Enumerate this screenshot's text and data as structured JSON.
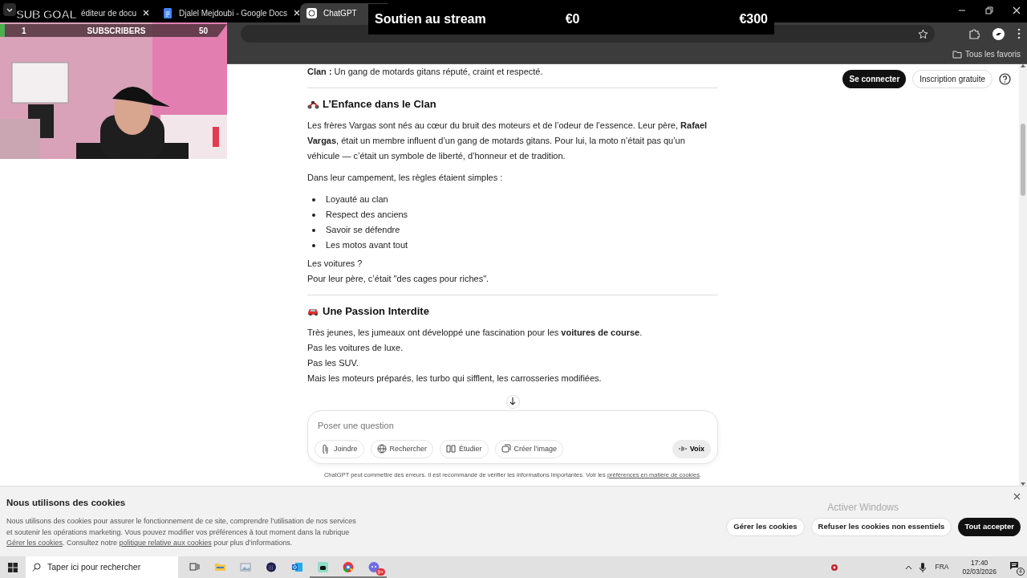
{
  "browser": {
    "tabs": [
      {
        "label": "éditeur de docu",
        "selected": false
      },
      {
        "label": "Djalel Mejdoubi - Google Docs",
        "selected": false
      },
      {
        "label": "ChatGPT",
        "selected": true
      }
    ],
    "bookmarks": [
      "Tous les favoris"
    ]
  },
  "page": {
    "header_buttons": [
      {
        "label": "Se connecter",
        "kind": "primary"
      },
      {
        "label": "Inscription gratuite",
        "kind": "outline"
      }
    ],
    "blocks": [
      {
        "kind": "paragraph",
        "text": "**Clan :** Un gang de motards gitans réputé, craint et respecté."
      },
      {
        "kind": "divider"
      },
      {
        "kind": "heading",
        "text": "L’Enfance dans le Clan"
      },
      {
        "kind": "paragraph",
        "text": "Les frères Vargas sont nés au cœur du bruit des moteurs et de l’odeur de l’essence. Leur père, **Rafael Vargas**, était un membre influent d’un gang de motards gitans. Pour lui, la moto n’était pas qu’un véhicule — c’était un symbole de liberté, d’honneur et de tradition."
      },
      {
        "kind": "paragraph",
        "text": "Dans leur campement, les règles étaient simples :"
      },
      {
        "kind": "list",
        "items": [
          "Loyauté au clan",
          "Respect des anciens",
          "Savoir se défendre",
          "Les motos avant tout"
        ]
      },
      {
        "kind": "lines",
        "lines": [
          "Les voitures ?",
          "Pour leur père, c’était \"des cages pour riches\"."
        ]
      },
      {
        "kind": "divider"
      },
      {
        "kind": "heading",
        "text": "Une Passion Interdite"
      },
      {
        "kind": "lines",
        "lines": [
          "Très jeunes, les jumeaux ont développé une fascination pour les **voitures de course**.",
          "Pas les voitures de luxe.",
          "Pas les SUV.",
          "Mais les moteurs préparés, les turbo qui sifflent, les carrosseries modifiées."
        ]
      }
    ]
  },
  "composer": {
    "placeholder": "Poser une question",
    "tools": [
      "Joindre",
      "Rechercher",
      "Étudier",
      "Créer l’image"
    ],
    "voice": "Voix"
  },
  "disclaimer": {
    "text": "ChatGPT peut commettre des erreurs. Il est recommandé de vérifier les informations importantes. Voir les",
    "link": "préférences en matière de cookies",
    "end": "."
  },
  "cookie_banner": {
    "title": "Nous utilisons des cookies",
    "body": [
      "Nous utilisons des cookies pour assurer le fonctionnement de ce site, comprendre l’utilisation de nos services et soutenir les opérations marketing. Vous pouvez modifier vos préférences à tout moment dans la rubrique ",
      {
        "link": "Gérer les cookies"
      },
      ". Consultez notre ",
      {
        "link": "politique relative aux cookies"
      },
      " pour plus d’informations."
    ],
    "buttons": [
      {
        "label": "Gérer les cookies",
        "kind": "outline"
      },
      {
        "label": "Refuser les cookies non essentiels",
        "kind": "outline"
      },
      {
        "label": "Tout accepter",
        "kind": "primary"
      }
    ]
  },
  "windows_notice": "Activer Windows",
  "taskbar": {
    "search_placeholder": "Taper ici pour rechercher",
    "apps": [
      {
        "kind": "taskview",
        "running": false
      },
      {
        "kind": "folder",
        "running": false
      },
      {
        "kind": "photos",
        "running": false
      },
      {
        "kind": "dial",
        "running": false
      },
      {
        "kind": "mail",
        "running": false
      },
      {
        "kind": "chat",
        "running": true
      },
      {
        "kind": "browser",
        "running": true
      },
      {
        "kind": "discord",
        "running": true,
        "badge": "9+"
      }
    ],
    "language": "FRA",
    "time": "17:40",
    "date": "02/03/2026",
    "notifications": "4"
  },
  "stream_overlay": {
    "sub_goal": {
      "title": "SUB GOAL",
      "current": "1",
      "label": "SUBSCRIBERS",
      "target": "50",
      "level": 0.02
    },
    "donation_goal": {
      "title": "Soutien au stream",
      "current": "€0",
      "target": "€300"
    }
  }
}
